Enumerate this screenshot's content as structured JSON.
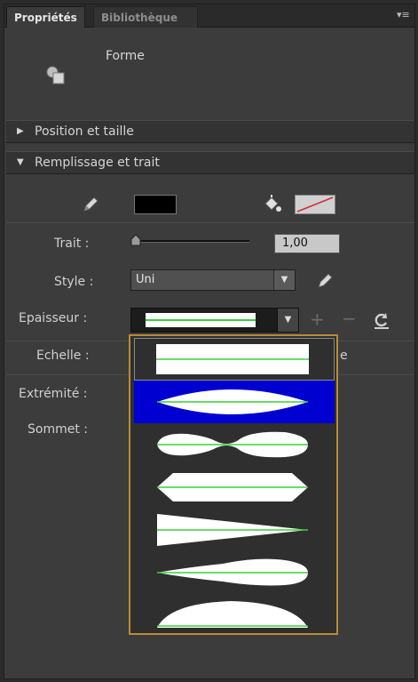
{
  "tabs": [
    {
      "label": "Propriétés",
      "active": true
    },
    {
      "label": "Bibliothèque",
      "active": false
    }
  ],
  "header": {
    "object_type": "Forme"
  },
  "sections": {
    "position": {
      "label": "Position et taille",
      "expanded": false
    },
    "fill_stroke": {
      "label": "Remplissage et trait",
      "expanded": true
    }
  },
  "stroke": {
    "fill_color": "#000000",
    "stroke_color": "none",
    "trait_label": "Trait :",
    "trait_value": "1,00",
    "style_label": "Style :",
    "style_value": "Uni",
    "epaisseur_label": "Epaisseur :",
    "echelle_label": "Echelle :",
    "extremite_label": "Extrémité :",
    "sommet_label": "Sommet :",
    "echelle_value_fragment": "e"
  },
  "width_profiles": {
    "selected_index": 1,
    "options": [
      "uniform",
      "lens",
      "double-bulge",
      "hex",
      "taper",
      "wave-taper",
      "dome"
    ]
  },
  "colors": {
    "accent_selection": "#0000d0",
    "popup_border": "#b98b35",
    "guide_line": "#39d139"
  }
}
